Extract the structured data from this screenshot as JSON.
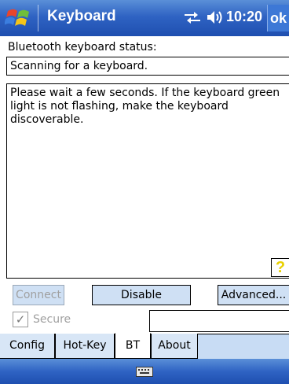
{
  "window": {
    "title": "Keyboard",
    "clock": "10:20",
    "ok_label": "ok",
    "start_icon": "windows-flag-icon",
    "tray_icons": [
      "connectivity-icon",
      "volume-icon"
    ]
  },
  "status": {
    "label": "Bluetooth keyboard status:",
    "value": "Scanning for a keyboard."
  },
  "message": {
    "text": "Please wait a few seconds. If the keyboard green light is not flashing, make the keyboard discoverable.",
    "help_glyph": "?"
  },
  "buttons": {
    "connect": "Connect",
    "disable": "Disable",
    "advanced": "Advanced..."
  },
  "secure": {
    "label": "Secure",
    "checked": true,
    "check_glyph": "✓"
  },
  "tabs": [
    {
      "label": "Config",
      "active": false
    },
    {
      "label": "Hot-Key",
      "active": false
    },
    {
      "label": "BT",
      "active": true
    },
    {
      "label": "About",
      "active": false
    }
  ],
  "bottombar": {
    "input_icon": "keyboard-icon"
  },
  "colors": {
    "titlebar": "#2f63c3",
    "button_bg": "#cfe0f4",
    "help_icon": "#e8d000"
  }
}
